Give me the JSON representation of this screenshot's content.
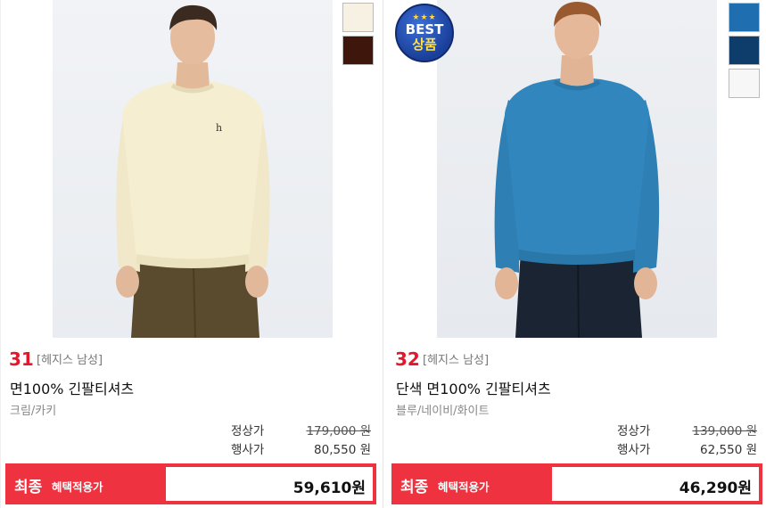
{
  "products": [
    {
      "rank": "31",
      "brand": "[헤지스 남성]",
      "name": "면100% 긴팔티셔츠",
      "colors": "크림/카키",
      "regular_label": "정상가",
      "regular_price": "179,000 원",
      "event_label": "행사가",
      "event_price": "80,550 원",
      "final_label": "최종",
      "final_sub": "혜택적용가",
      "final_price": "59,610원",
      "swatches": [
        "#f6f1e3",
        "#3e160b"
      ],
      "logo_letter": "h"
    },
    {
      "rank": "32",
      "brand": "[헤지스 남성]",
      "name": "단색 면100% 긴팔티셔츠",
      "colors": "블루/네이비/화이트",
      "regular_label": "정상가",
      "regular_price": "139,000 원",
      "event_label": "행사가",
      "event_price": "62,550 원",
      "final_label": "최종",
      "final_sub": "혜택적용가",
      "final_price": "46,290원",
      "swatches": [
        "#1f6fb0",
        "#0e3d6b",
        "#f7f7f7"
      ],
      "badge": {
        "stars": "★★★",
        "line1": "BEST",
        "line2": "상품"
      }
    }
  ]
}
